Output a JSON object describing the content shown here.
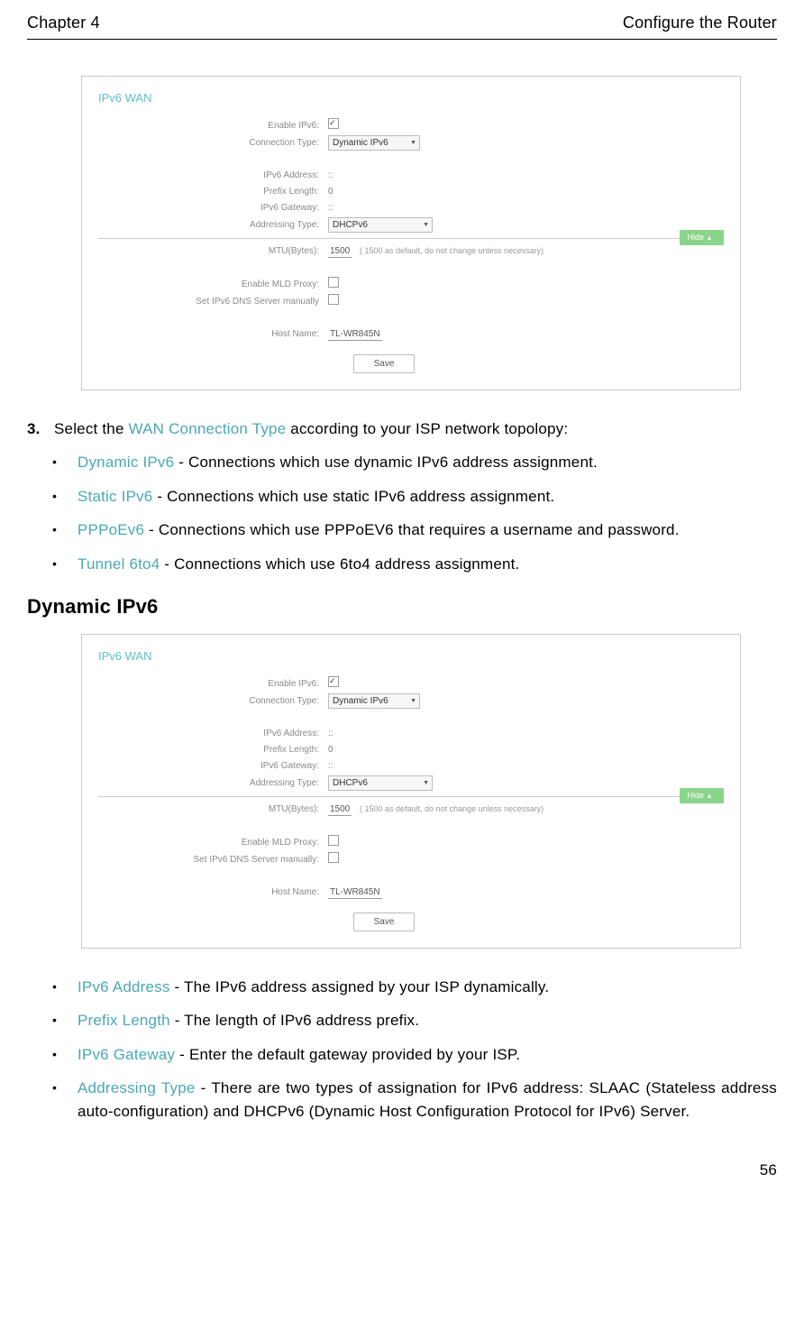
{
  "header": {
    "left": "Chapter 4",
    "right": "Configure the Router"
  },
  "screenshot1": {
    "title": "IPv6 WAN",
    "labels": {
      "enable_ipv6": "Enable IPv6:",
      "connection_type": "Connection Type:",
      "ipv6_address": "IPv6 Address:",
      "prefix_length": "Prefix Length:",
      "ipv6_gateway": "IPv6 Gateway:",
      "addressing_type": "Addressing Type:",
      "mtu": "MTU(Bytes):",
      "enable_mld": "Enable MLD Proxy:",
      "dns_manual": "Set IPv6 DNS Server manually",
      "host_name": "Host Name:"
    },
    "values": {
      "connection_type": "Dynamic IPv6",
      "ipv6_address": "::",
      "prefix_length": "0",
      "ipv6_gateway": "::",
      "addressing_type": "DHCPv6",
      "mtu": "1500",
      "mtu_note": "( 1500 as default, do not change unless necessary)",
      "host_name": "TL-WR845N",
      "hide_btn": "Hide",
      "save_btn": "Save"
    }
  },
  "step3": {
    "num": "3.",
    "prefix": "Select the ",
    "highlight": "WAN Connection Type",
    "suffix": " according to your ISP network topolopy:"
  },
  "types": [
    {
      "name": "Dynamic IPv6",
      "desc": " - Connections which use dynamic IPv6 address assignment."
    },
    {
      "name": "Static IPv6",
      "desc": " - Connections which use static IPv6 address assignment."
    },
    {
      "name": "PPPoEv6",
      "desc": " - Connections which use PPPoEV6 that requires a username and password."
    },
    {
      "name": "Tunnel 6to4",
      "desc": " - Connections which use 6to4 address assignment."
    }
  ],
  "section_heading": "Dynamic IPv6",
  "screenshot2": {
    "title": "IPv6 WAN",
    "labels": {
      "enable_ipv6": "Enable IPv6:",
      "connection_type": "Connection Type:",
      "ipv6_address": "IPv6 Address:",
      "prefix_length": "Prefix Length:",
      "ipv6_gateway": "IPv6 Gateway:",
      "addressing_type": "Addressing Type:",
      "mtu": "MTU(Bytes):",
      "enable_mld": "Enable MLD Proxy:",
      "dns_manual": "Set IPv6 DNS Server manually:",
      "host_name": "Host Name:"
    },
    "values": {
      "connection_type": "Dynamic IPv6",
      "ipv6_address": "::",
      "prefix_length": "0",
      "ipv6_gateway": "::",
      "addressing_type": "DHCPv6",
      "mtu": "1500",
      "mtu_note": "( 1500 as default, do not change unless necessary)",
      "host_name": "TL-WR845N",
      "hide_btn": "Hide",
      "save_btn": "Save"
    }
  },
  "fields": [
    {
      "name": "IPv6 Address",
      "desc": " - The IPv6 address assigned by your ISP dynamically."
    },
    {
      "name": "Prefix Length",
      "desc": " - The length of IPv6 address prefix."
    },
    {
      "name": "IPv6 Gateway",
      "desc": " - Enter the default gateway provided by your ISP."
    },
    {
      "name": "Addressing Type",
      "desc": " - There are two types of assignation for IPv6 address: SLAAC (Stateless address auto-configuration) and DHCPv6 (Dynamic Host Configuration Protocol for IPv6) Server."
    }
  ],
  "page_num": "56"
}
